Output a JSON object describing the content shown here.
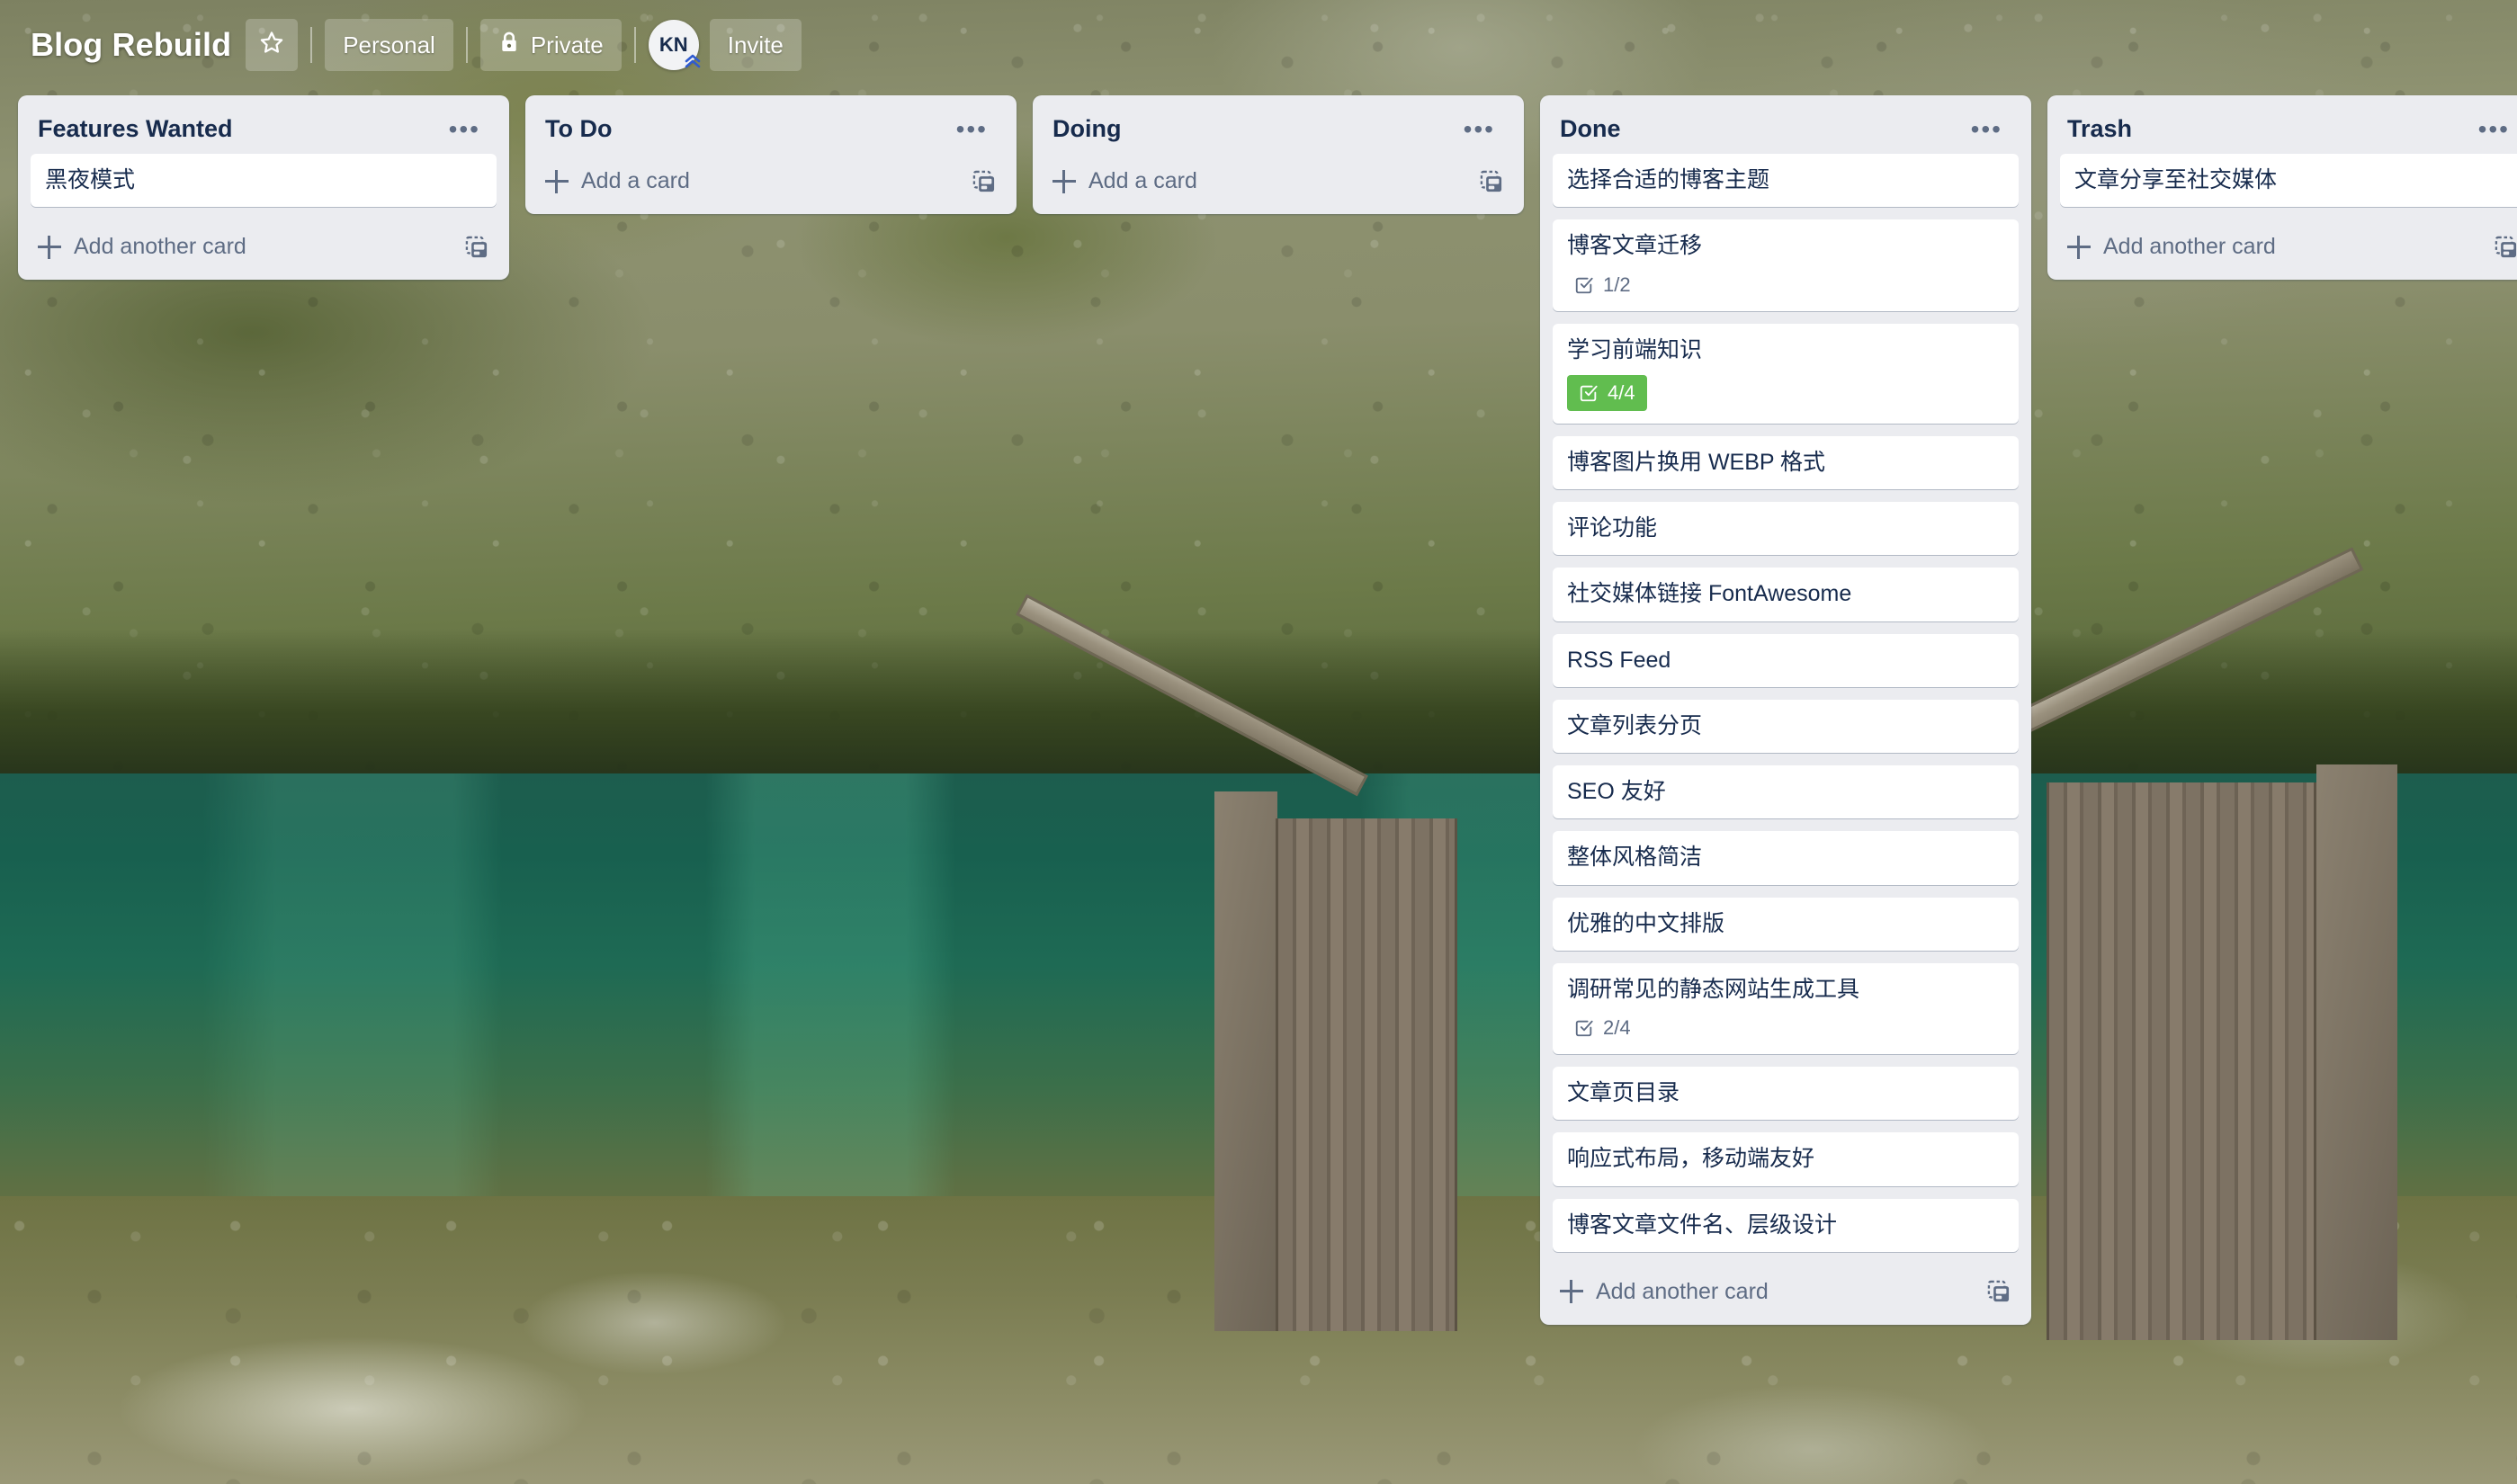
{
  "header": {
    "board_title": "Blog Rebuild",
    "star_label": "Star board",
    "workspace_label": "Personal",
    "visibility_label": "Private",
    "avatar_initials": "KN",
    "invite_label": "Invite",
    "icons": {
      "star": "star-icon",
      "lock": "lock-icon",
      "chevrons_up": "chevrons-up-icon"
    }
  },
  "colors": {
    "list_background": "#EBECF0",
    "card_background": "#FFFFFF",
    "text_primary": "#172B4D",
    "text_subtle": "#5E6C84",
    "badge_complete_green": "#61BD4F"
  },
  "labels": {
    "add_a_card": "Add a card",
    "add_another_card": "Add another card",
    "list_menu": "•••",
    "template_icon": "card-template-icon"
  },
  "lists": [
    {
      "title": "Features Wanted",
      "add_label": "Add another card",
      "cards": [
        {
          "title": "黑夜模式"
        }
      ]
    },
    {
      "title": "To Do",
      "add_label": "Add a card",
      "cards": []
    },
    {
      "title": "Doing",
      "add_label": "Add a card",
      "cards": []
    },
    {
      "title": "Done",
      "add_label": "Add another card",
      "cards": [
        {
          "title": "选择合适的博客主题"
        },
        {
          "title": "博客文章迁移",
          "checklist": "1/2",
          "checklist_complete": false
        },
        {
          "title": "学习前端知识",
          "checklist": "4/4",
          "checklist_complete": true
        },
        {
          "title": "博客图片换用 WEBP 格式"
        },
        {
          "title": "评论功能"
        },
        {
          "title": "社交媒体链接 FontAwesome"
        },
        {
          "title": "RSS Feed"
        },
        {
          "title": "文章列表分页"
        },
        {
          "title": "SEO 友好"
        },
        {
          "title": "整体风格简洁"
        },
        {
          "title": "优雅的中文排版"
        },
        {
          "title": "调研常见的静态网站生成工具",
          "checklist": "2/4",
          "checklist_complete": false
        },
        {
          "title": "文章页目录"
        },
        {
          "title": "响应式布局，移动端友好"
        },
        {
          "title": "博客文章文件名、层级设计"
        }
      ]
    },
    {
      "title": "Trash",
      "add_label": "Add another card",
      "cards": [
        {
          "title": "文章分享至社交媒体"
        }
      ]
    }
  ]
}
